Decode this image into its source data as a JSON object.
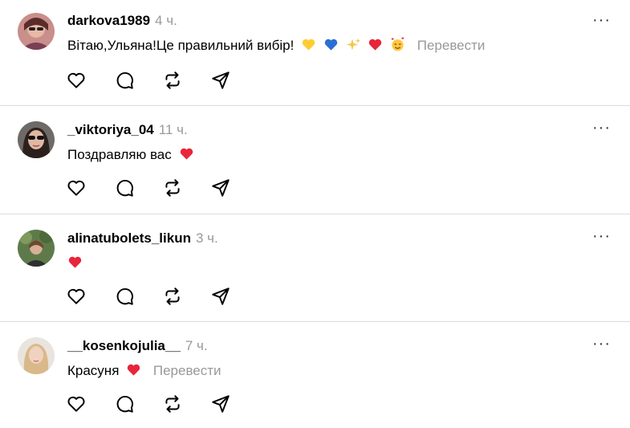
{
  "comments": [
    {
      "username": "darkova1989",
      "time": "4 ч.",
      "text": "Вітаю,Ульяна!Це правильний вибір!",
      "emojis": [
        "yellow-heart-icon",
        "blue-heart-icon",
        "sparkles-icon",
        "red-heart-icon",
        "smiling-face-with-hearts-icon"
      ],
      "translate": "Перевести"
    },
    {
      "username": "_viktoriya_04",
      "time": "11 ч.",
      "text": "Поздравляю вас",
      "emojis": [
        "red-heart-icon"
      ]
    },
    {
      "username": "alinatubolets_likun",
      "time": "3 ч.",
      "text": "",
      "emojis": [
        "red-heart-icon"
      ]
    },
    {
      "username": "__kosenkojulia__",
      "time": "7 ч.",
      "text": "Красуня",
      "emojis": [
        "red-heart-icon"
      ],
      "translate": "Перевести"
    }
  ],
  "more_label": "···",
  "action_icons": [
    "heart-icon",
    "comment-icon",
    "repost-icon",
    "share-icon"
  ],
  "colors": {
    "text": "#000000",
    "muted": "#999999",
    "divider": "#dcdcdc",
    "red_heart": "#e8253b",
    "yellow_heart": "#ffcc33",
    "blue_heart": "#2a6fd6"
  }
}
